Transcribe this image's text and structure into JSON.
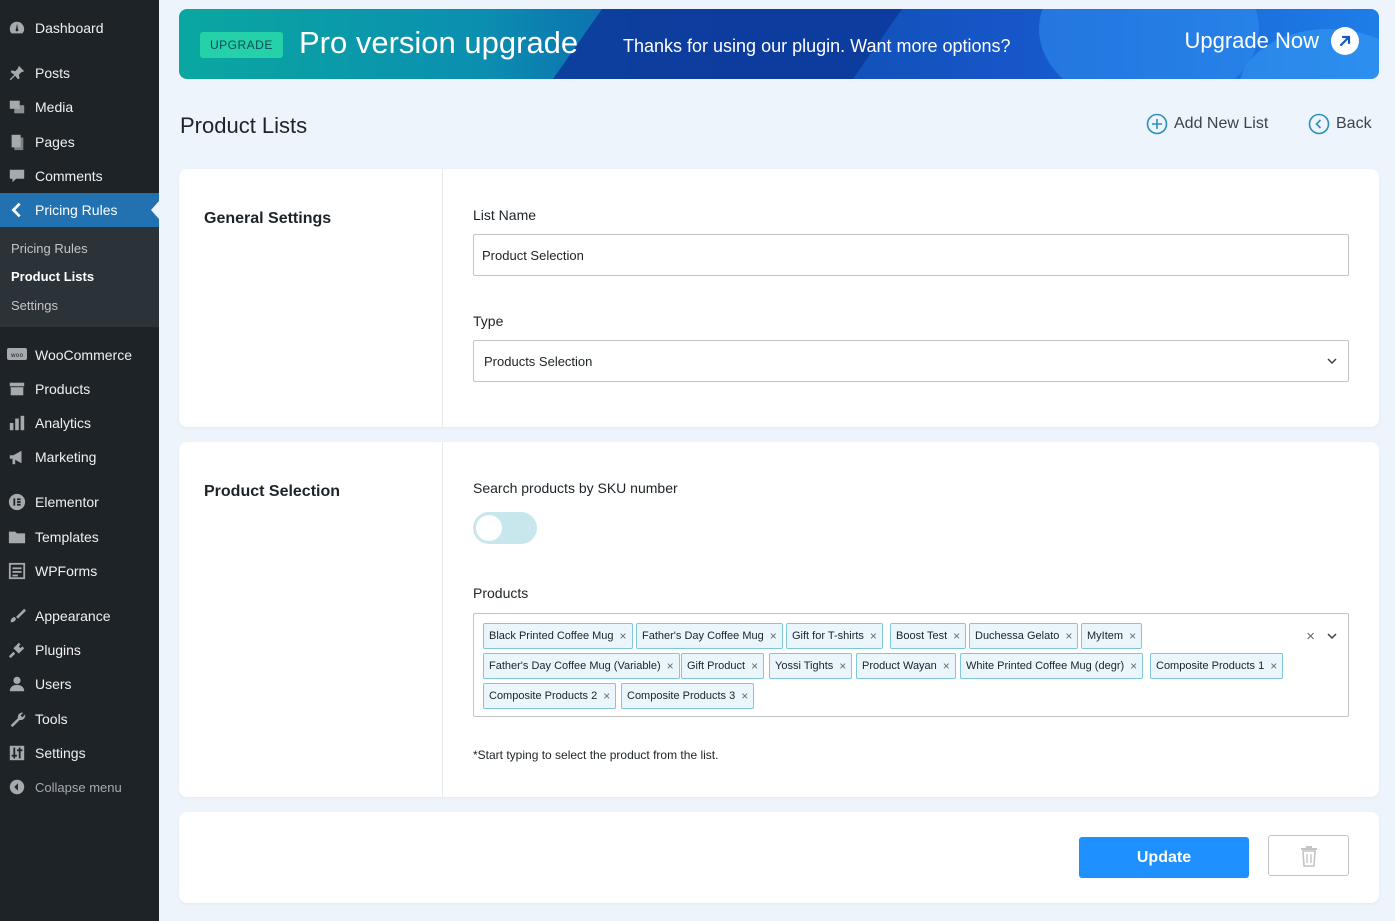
{
  "sidebar": {
    "items": [
      {
        "label": "Dashboard",
        "icon": "dashboard-icon"
      },
      {
        "label": "Posts",
        "icon": "pin-icon"
      },
      {
        "label": "Media",
        "icon": "media-icon"
      },
      {
        "label": "Pages",
        "icon": "pages-icon"
      },
      {
        "label": "Comments",
        "icon": "comment-icon"
      },
      {
        "label": "Pricing Rules",
        "icon": "chevron-left-icon"
      },
      {
        "label": "WooCommerce",
        "icon": "woo-icon"
      },
      {
        "label": "Products",
        "icon": "archive-icon"
      },
      {
        "label": "Analytics",
        "icon": "bar-chart-icon"
      },
      {
        "label": "Marketing",
        "icon": "megaphone-icon"
      },
      {
        "label": "Elementor",
        "icon": "elementor-icon"
      },
      {
        "label": "Templates",
        "icon": "folder-icon"
      },
      {
        "label": "WPForms",
        "icon": "form-icon"
      },
      {
        "label": "Appearance",
        "icon": "brush-icon"
      },
      {
        "label": "Plugins",
        "icon": "plug-icon"
      },
      {
        "label": "Users",
        "icon": "user-icon"
      },
      {
        "label": "Tools",
        "icon": "wrench-icon"
      },
      {
        "label": "Settings",
        "icon": "sliders-icon"
      }
    ],
    "submenu": [
      "Pricing Rules",
      "Product Lists",
      "Settings"
    ],
    "collapse_label": "Collapse menu"
  },
  "banner": {
    "badge": "UPGRADE",
    "title": "Pro version upgrade",
    "subtitle": "Thanks for using our plugin. Want more options?",
    "cta": "Upgrade Now"
  },
  "header": {
    "title": "Product Lists",
    "add_new": "Add New List",
    "back": "Back"
  },
  "general": {
    "section_title": "General Settings",
    "list_name_label": "List Name",
    "list_name_value": "Product Selection",
    "type_label": "Type",
    "type_value": "Products Selection"
  },
  "selection": {
    "section_title": "Product Selection",
    "sku_label": "Search products by SKU number",
    "sku_toggle_on": false,
    "products_label": "Products",
    "products": [
      "Black Printed Coffee Mug",
      "Father's Day Coffee Mug",
      "Gift for T-shirts",
      "Boost Test",
      "Duchessa Gelato",
      "MyItem",
      "Father's Day Coffee Mug (Variable)",
      "Gift Product",
      "Yossi Tights",
      "Product Wayan",
      "White Printed Coffee Mug (degr)",
      "Composite Products 1",
      "Composite Products 2",
      "Composite Products 3"
    ],
    "hint": "*Start typing to select the product from the list."
  },
  "actions": {
    "update": "Update"
  },
  "colors": {
    "sidebar_bg": "#1d2327",
    "active_menu": "#2271b1",
    "primary_button": "#1e90ff",
    "tag_border": "#7fc7d9"
  }
}
